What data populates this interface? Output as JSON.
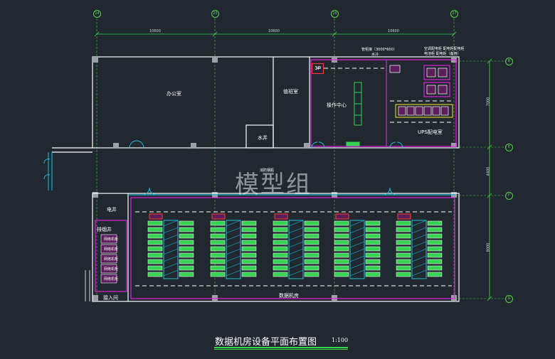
{
  "axes_top": [
    "24",
    "25",
    "26",
    "27"
  ],
  "axes_right": [
    "B",
    "E",
    "F",
    "G"
  ],
  "dims_top": [
    "10600",
    "10600",
    "10600"
  ],
  "dims_right": [
    "7000",
    "4400",
    "8000"
  ],
  "rooms": {
    "office": "办公室",
    "duty": "值班室",
    "water_well": "水井",
    "ops_center": "操作中心",
    "ups_room": "UPS配电室",
    "electric_well": "电井",
    "drain_well": "排烟井",
    "access_room": "接入间",
    "data_room": "数据机房",
    "fire_equip": "消防钢瓶"
  },
  "notes": {
    "equip_label_1": "管柜接（3000*600）",
    "equip_label_2": "水冷",
    "equip_label_3": "空调配电柜 配电柜配电柜",
    "equip_label_4": "电池柜 配电柜（备用）"
  },
  "tag_3p": "3P",
  "access_racks": [
    "网络机柜",
    "网络机柜",
    "网络机柜",
    "网络机柜",
    "网络机柜"
  ],
  "watermark": "模型组",
  "drawing_title": "数据机房设备平面布置图",
  "drawing_scale": "1:100",
  "colors": {
    "wall": "#ffffff",
    "room_outline": "#e020e0",
    "rack_fill": "#39d353",
    "rack_outline": "#ffffff",
    "aisle": "#22bcd8",
    "dim": "#3bd84a",
    "background": "#212830"
  }
}
